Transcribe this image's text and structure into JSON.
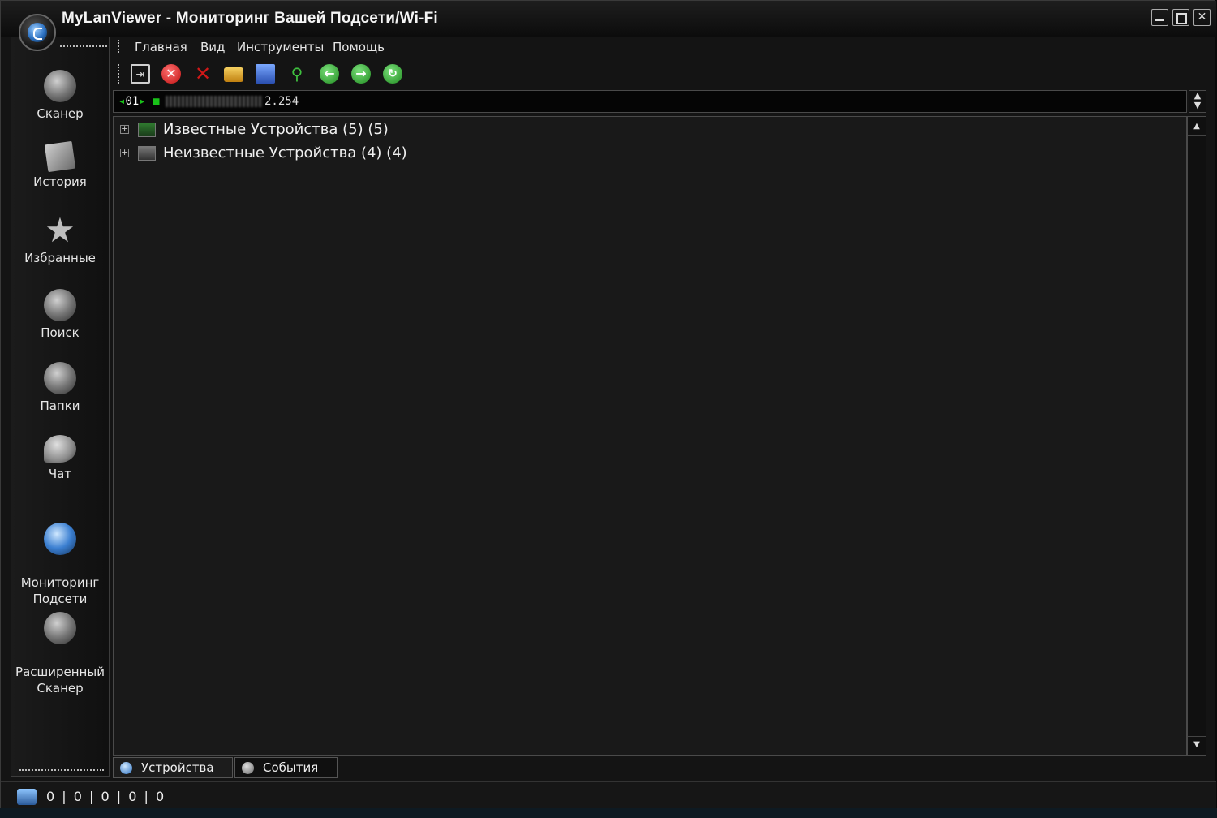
{
  "window": {
    "title": "MyLanViewer - Мониторинг Вашей Подсети/Wi-Fi"
  },
  "sidebar": {
    "items": [
      {
        "label": "Сканер",
        "icon": "scanner-globe-icon"
      },
      {
        "label": "История",
        "icon": "history-icon"
      },
      {
        "label": "Избранные",
        "icon": "star-icon"
      },
      {
        "label": "Поиск",
        "icon": "search-globe-icon"
      },
      {
        "label": "Папки",
        "icon": "folders-globe-icon"
      },
      {
        "label": "Чат",
        "icon": "chat-bubble-icon"
      },
      {
        "label": "Мониторинг\nПодсети",
        "icon": "subnet-monitor-icon"
      },
      {
        "label": "Расширенный\nСканер",
        "icon": "extended-scanner-icon"
      }
    ]
  },
  "menu": {
    "items": [
      "Главная",
      "Вид",
      "Инструменты",
      "Помощь"
    ]
  },
  "toolbar": {
    "buttons": [
      {
        "name": "export-icon",
        "color": "#cfcfcf"
      },
      {
        "name": "stop-icon",
        "color": "#e02020"
      },
      {
        "name": "delete-icon",
        "color": "#d01818"
      },
      {
        "name": "open-folder-icon",
        "color": "#e8b020"
      },
      {
        "name": "save-icon",
        "color": "#3a6fd8"
      },
      {
        "name": "search-icon",
        "color": "#3fbf3f"
      },
      {
        "name": "back-icon",
        "color": "#2fae2f"
      },
      {
        "name": "forward-icon",
        "color": "#2fae2f"
      },
      {
        "name": "refresh-icon",
        "color": "#2fae2f"
      }
    ]
  },
  "address": {
    "prefix": "01",
    "value_visible": "2.254"
  },
  "tree": {
    "nodes": [
      {
        "label": "Известные Устройства (5) (5)"
      },
      {
        "label": "Неизвестные Устройства (4) (4)"
      }
    ]
  },
  "tabs": [
    {
      "label": "Устройства"
    },
    {
      "label": "События"
    }
  ],
  "status": {
    "counts": "0 | 0 | 0 | 0 | 0"
  }
}
